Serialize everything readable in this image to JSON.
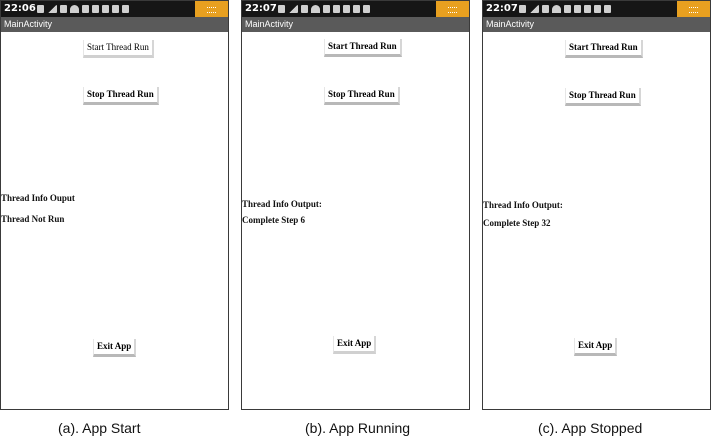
{
  "panels": [
    {
      "time": "22:06",
      "app_title": "MainActivity",
      "start_button": "Start Thread Run",
      "stop_button": "Stop Thread Run",
      "info_label": "Thread Info Ouput",
      "info_value": "Thread Not Run",
      "exit_button": "Exit App",
      "caption": "(a). App Start"
    },
    {
      "time": "22:07",
      "app_title": "MainActivity",
      "start_button": "Start Thread Run",
      "stop_button": "Stop Thread Run",
      "info_label": "Thread Info Output:",
      "info_value": "Complete Step 6",
      "exit_button": "Exit App",
      "caption": "(b). App Running"
    },
    {
      "time": "22:07",
      "app_title": "MainActivity",
      "start_button": "Start Thread Run",
      "stop_button": "Stop Thread Run",
      "info_label": "Thread Info Output:",
      "info_value": "Complete Step 32",
      "exit_button": "Exit App",
      "caption": "(c). App Stopped"
    }
  ],
  "colors": {
    "status_bar": "#161616",
    "title_bar": "#5a5a5a",
    "notification": "#e8a020"
  }
}
